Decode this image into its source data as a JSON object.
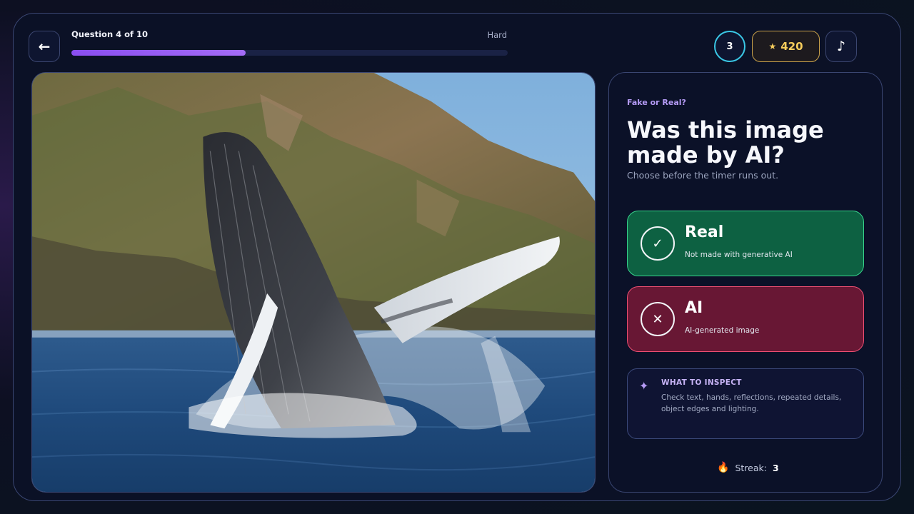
{
  "header": {
    "back_icon": "arrow-left-icon",
    "question_label": "Question 4 of 10",
    "difficulty": "Hard",
    "progress_fraction": 0.4,
    "progress_color": "#8a4ef0",
    "timer_value": "3",
    "timer_color": "#3ac8e6",
    "score_icon": "star-icon",
    "score_value": "420",
    "score_color": "#f7cd5c",
    "music_icon": "music-note-icon"
  },
  "photo": {
    "subject": "breaching humpback whale"
  },
  "panel": {
    "eyebrow": "Fake or Real?",
    "headline": "Was this image made by AI?",
    "subline": "Choose before the timer runs out.",
    "choices": [
      {
        "icon": "checkmark-icon",
        "title": "Real",
        "desc": "Not made with generative AI",
        "color": "#0d6142"
      },
      {
        "icon": "x-icon",
        "title": "AI",
        "desc": "AI-generated image",
        "color": "#681734"
      }
    ],
    "inspect": {
      "icon": "sparkle-icon",
      "heading": "WHAT TO INSPECT",
      "body": "Check text, hands, reflections, repeated details, object edges and lighting."
    },
    "streak": {
      "icon": "flame-icon",
      "label": "Streak:",
      "value": "3"
    }
  }
}
